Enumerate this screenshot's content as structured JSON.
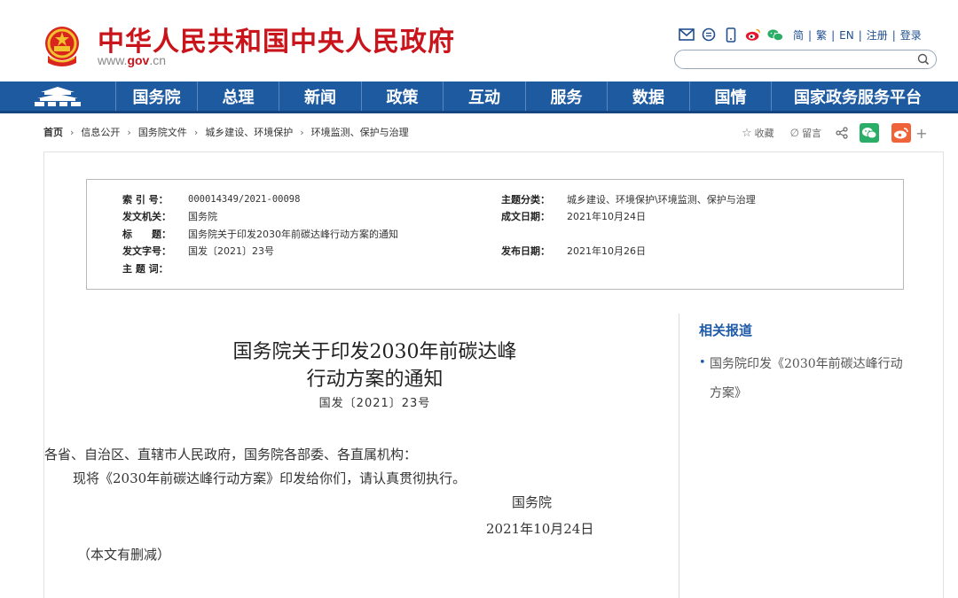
{
  "header": {
    "title": "中华人民共和国中央人民政府",
    "url_prefix": "www.",
    "url_gov": "gov",
    "url_suffix": ".cn",
    "top_links": [
      "简",
      "繁",
      "EN",
      "注册",
      "登录"
    ],
    "search_placeholder": "",
    "icons": [
      "mail-icon",
      "chat-icon",
      "mobile-icon",
      "weibo-icon",
      "wechat-icon"
    ]
  },
  "nav": {
    "items": [
      "国务院",
      "总理",
      "新闻",
      "政策",
      "互动",
      "服务",
      "数据",
      "国情",
      "国家政务服务平台"
    ],
    "home_icon": "tiananmen-icon",
    "bg_color": "#1e5aa0"
  },
  "breadcrumb": [
    "首页",
    "信息公开",
    "国务院文件",
    "城乡建设、环境保护",
    "环境监测、保护与治理"
  ],
  "share": {
    "favorite": "收藏",
    "comment": "留言",
    "icons": [
      "star-icon",
      "pen-icon",
      "share-icon",
      "wechat-icon",
      "weibo-icon",
      "plus-icon"
    ]
  },
  "meta": {
    "index_label": "索 引 号：",
    "index_value": "000014349/2021-00098",
    "topic_label": "主题分类：",
    "topic_value": "城乡建设、环境保护\\环境监测、保护与治理",
    "issuer_label": "发文机关：",
    "issuer_value": "国务院",
    "written_label": "成文日期：",
    "written_value": "2021年10月24日",
    "title_label": "标　　题：",
    "title_value": "国务院关于印发2030年前碳达峰行动方案的通知",
    "docno_label": "发文字号：",
    "docno_value": "国发〔2021〕23号",
    "published_label": "发布日期：",
    "published_value": "2021年10月26日",
    "keywords_label": "主 题 词："
  },
  "article": {
    "title_line1": "国务院关于印发2030年前碳达峰",
    "title_line2": "行动方案的通知",
    "doc_number": "国发〔2021〕23号",
    "recipients": "各省、自治区、直辖市人民政府，国务院各部委、各直属机构：",
    "body": "现将《2030年前碳达峰行动方案》印发给你们，请认真贯彻执行。",
    "signature": "国务院",
    "date": "2021年10月24日",
    "note": "（本文有删减）"
  },
  "related": {
    "title": "相关报道",
    "items": [
      "国务院印发《2030年前碳达峰行动方案》"
    ]
  }
}
